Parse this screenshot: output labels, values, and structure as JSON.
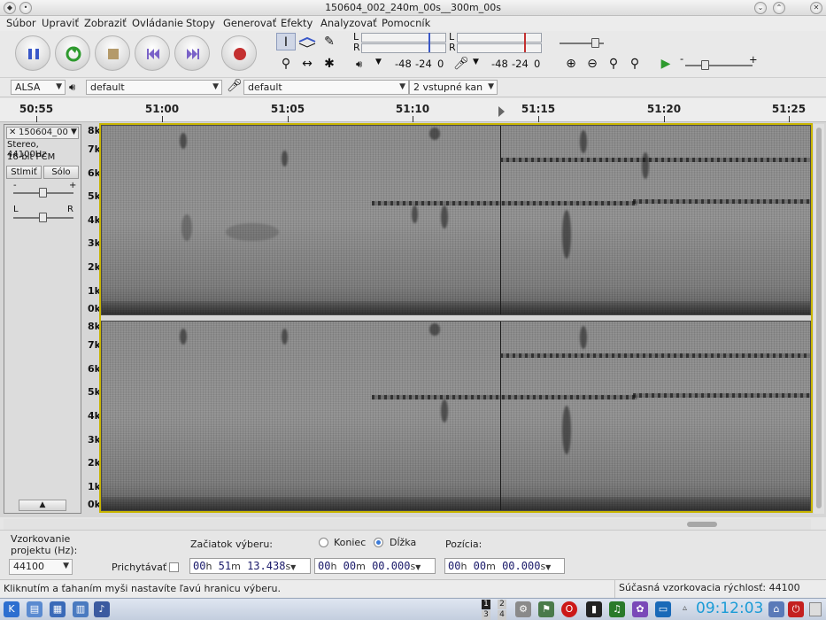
{
  "window": {
    "title": "150604_002_240m_00s__300m_00s"
  },
  "menu": [
    "Súbor",
    "Upraviť",
    "Zobraziť",
    "Ovládanie",
    "Stopy",
    "Generovať",
    "Efekty",
    "Analyzovať",
    "Pomocník"
  ],
  "meters": {
    "play_l": "L",
    "play_r": "R",
    "rec_l": "L",
    "rec_r": "R",
    "play_m48": "-48",
    "play_m24": "-24",
    "play_0": "0",
    "rec_m48": "-48",
    "rec_m24": "-24",
    "rec_0": "0"
  },
  "devices": {
    "host": "ALSA",
    "output": "default",
    "input": "default",
    "channels": "2 vstupné kan"
  },
  "ruler": {
    "labels": [
      "50:55",
      "51:00",
      "51:05",
      "51:10",
      "51:15",
      "51:20",
      "51:25"
    ]
  },
  "track": {
    "name": "150604_00",
    "info1": "Stereo, 44100Hz",
    "info2": "16-bit PCM",
    "mute": "Stlmiť",
    "solo": "Sólo",
    "gain_minus": "-",
    "gain_plus": "+",
    "pan_l": "L",
    "pan_r": "R",
    "freq_labels": [
      "8k",
      "7k",
      "6k",
      "5k",
      "4k",
      "3k",
      "2k",
      "1k",
      "0k"
    ]
  },
  "selection": {
    "rate_label_1": "Vzorkovanie",
    "rate_label_2": "projektu (Hz):",
    "rate_value": "44100",
    "snap_label": "Prichytávať",
    "start_label": "Začiatok výberu:",
    "end_option": "Koniec",
    "length_option": "Dĺžka",
    "position_label": "Pozícia:",
    "start_time": {
      "h": "00",
      "m": "51",
      "s": "13.438"
    },
    "length_time": {
      "h": "00",
      "m": "00",
      "s": "00.000"
    },
    "position_time": {
      "h": "00",
      "m": "00",
      "s": "00.000"
    },
    "unit_h": "h",
    "unit_m": "m",
    "unit_s": "s"
  },
  "status": {
    "message": "Kliknutím a ťahaním myši nastavíte ľavú hranicu výberu.",
    "rate": "Súčasná vzorkovacia rýchlosť: 44100"
  },
  "taskbar": {
    "clock": "09:12:03",
    "desk1": "1",
    "desk2": "2",
    "desk3": "3",
    "desk4": "4"
  }
}
